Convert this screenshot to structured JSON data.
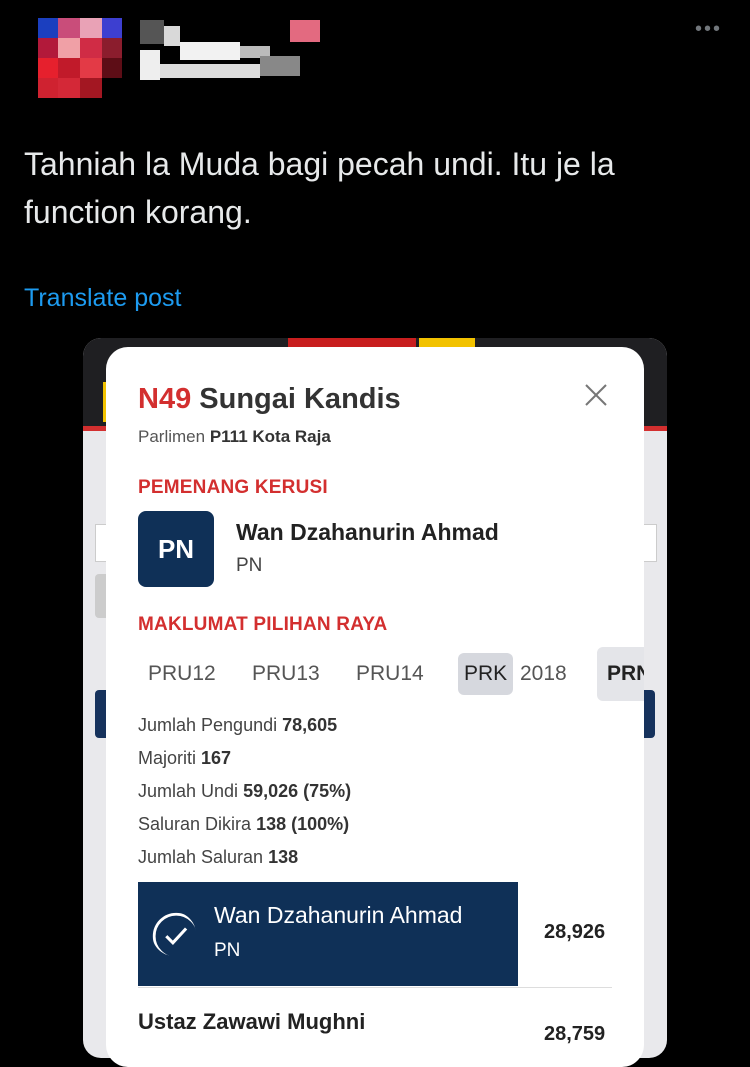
{
  "tweet": {
    "text": "Tahniah la Muda bagi pecah undi. Itu je la function korang.",
    "translate_label": "Translate post",
    "more_icon": "more-icon"
  },
  "card": {
    "code": "N49",
    "name": "Sungai Kandis",
    "subtitle_prefix": "Parlimen",
    "parliament": "P111 Kota Raja",
    "winner_heading": "PEMENANG KERUSI",
    "winner_logo": "PN",
    "winner_name": "Wan Dzahanurin Ahmad",
    "winner_party": "PN",
    "info_heading": "MAKLUMAT PILIHAN RAYA",
    "tabs": [
      "PRU12",
      "PRU13",
      "PRU14",
      "PRK",
      "2018",
      "PRN"
    ],
    "selected_tab": "PRK",
    "stats": [
      {
        "label": "Jumlah Pengundi",
        "value": "78,605"
      },
      {
        "label": "Majoriti",
        "value": "167"
      },
      {
        "label": "Jumlah Undi",
        "value": "59,026 (75%)"
      },
      {
        "label": "Saluran Dikira",
        "value": "138 (100%)"
      },
      {
        "label": "Jumlah Saluran",
        "value": "138"
      }
    ],
    "results": [
      {
        "name": "Wan Dzahanurin Ahmad",
        "party": "PN",
        "votes": "28,926"
      },
      {
        "name": "Ustaz Zawawi Mughni",
        "votes": "28,759"
      }
    ]
  },
  "colors": {
    "background": "#000000",
    "link": "#1d9bf0",
    "accent_red": "#d32f2f",
    "navy": "#0f3057"
  }
}
